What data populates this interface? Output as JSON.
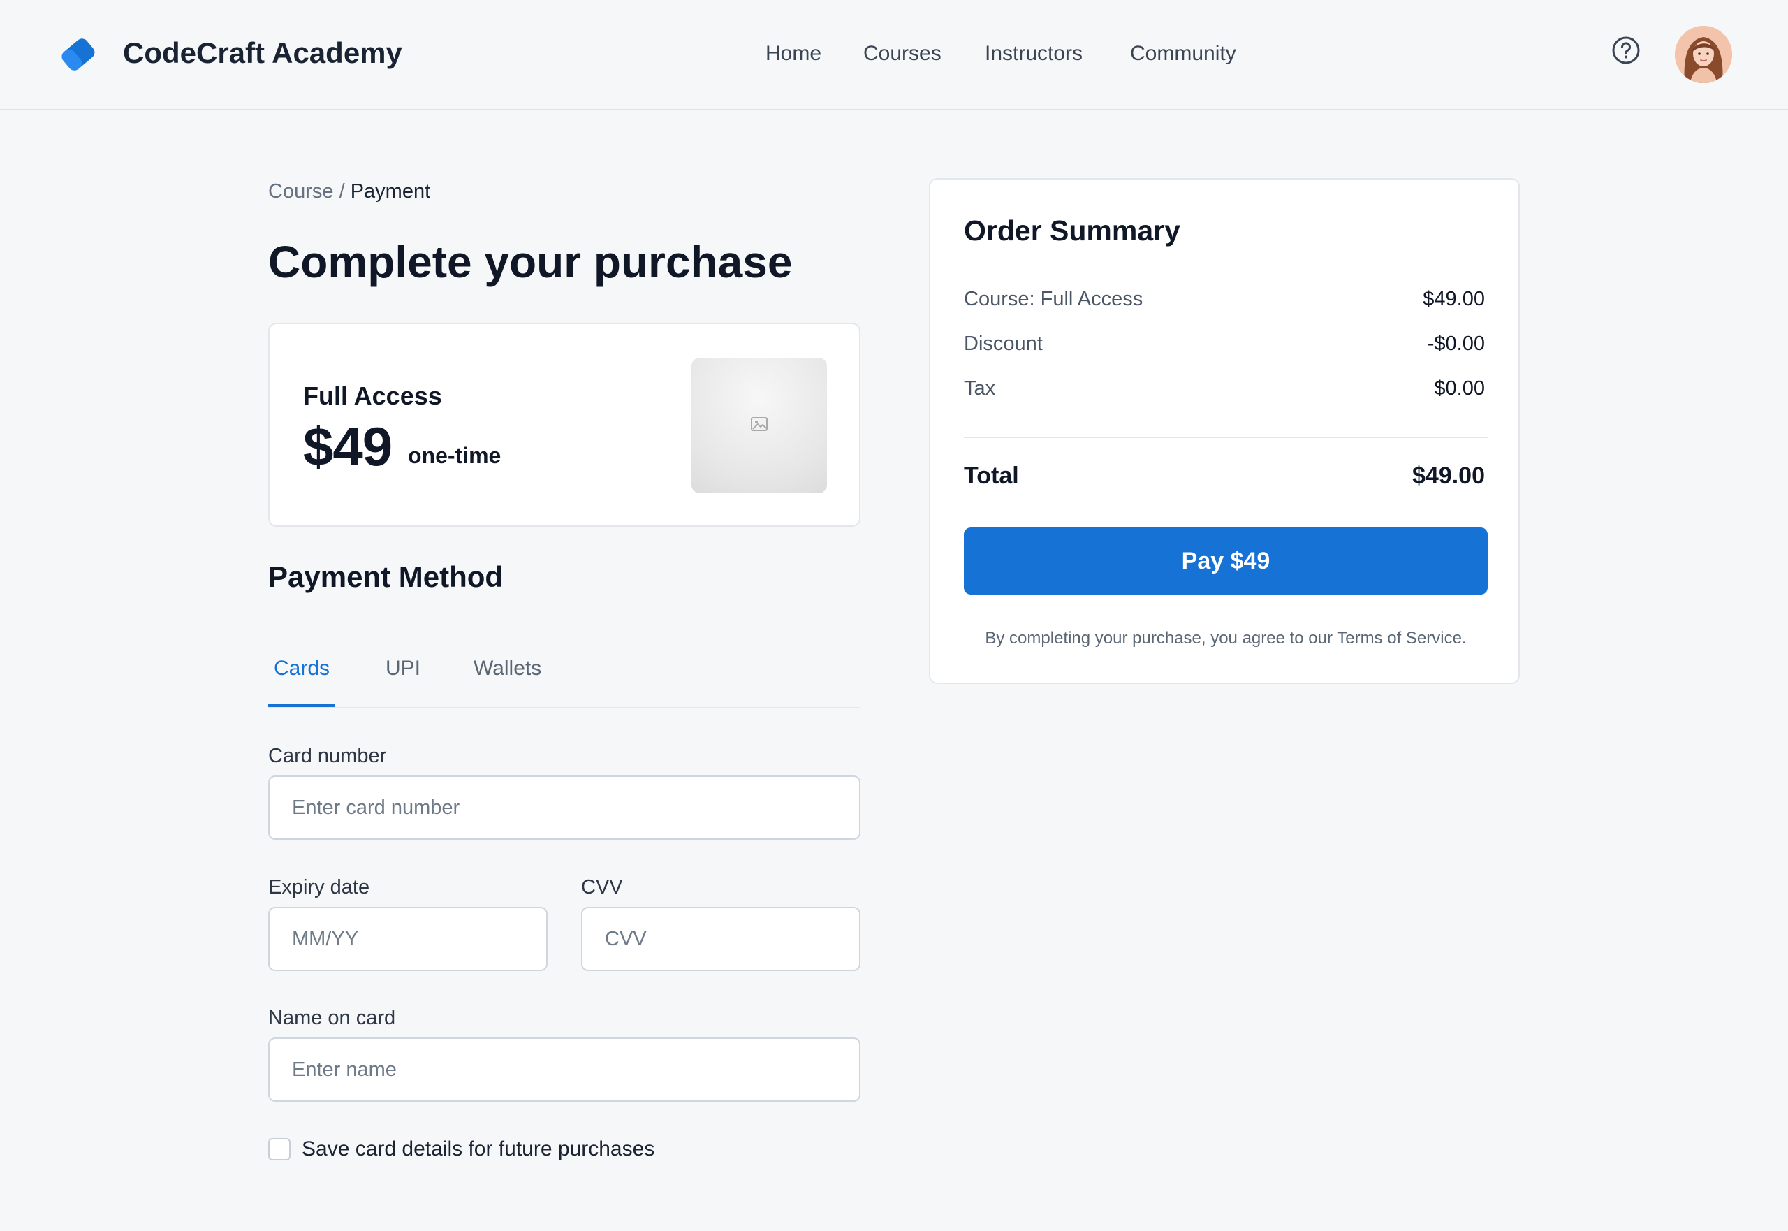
{
  "header": {
    "brand": "CodeCraft Academy",
    "nav": [
      "Home",
      "Courses",
      "Instructors",
      "Community"
    ],
    "icons": {
      "logo": "tag-logo-icon",
      "help": "help-circle-icon",
      "avatar": "user-avatar"
    }
  },
  "breadcrumb": {
    "parent": "Course",
    "separator": "/",
    "current": "Payment"
  },
  "page_title": "Complete your purchase",
  "plan": {
    "name": "Full Access",
    "price": "$49",
    "period": "one-time",
    "image_icon": "image-placeholder-icon"
  },
  "payment": {
    "title": "Payment Method",
    "tabs": [
      {
        "label": "Cards",
        "active": true
      },
      {
        "label": "UPI",
        "active": false
      },
      {
        "label": "Wallets",
        "active": false
      }
    ],
    "fields": {
      "card_number": {
        "label": "Card number",
        "placeholder": "Enter card number",
        "value": ""
      },
      "expiry": {
        "label": "Expiry date",
        "placeholder": "MM/YY",
        "value": ""
      },
      "cvv": {
        "label": "CVV",
        "placeholder": "CVV",
        "value": ""
      },
      "name": {
        "label": "Name on card",
        "placeholder": "Enter name",
        "value": ""
      }
    },
    "save_card": {
      "label": "Save card details for future purchases",
      "checked": false
    }
  },
  "summary": {
    "title": "Order Summary",
    "rows": [
      {
        "label": "Course: Full Access",
        "value": "$49.00"
      },
      {
        "label": "Discount",
        "value": "-$0.00"
      },
      {
        "label": "Tax",
        "value": "$0.00"
      }
    ],
    "total_label": "Total",
    "total_value": "$49.00",
    "pay_label": "Pay $49",
    "terms": "By completing your purchase, you agree to our Terms of Service."
  },
  "colors": {
    "accent": "#1672d4",
    "background": "#f5f7f9",
    "text": "#101828"
  }
}
